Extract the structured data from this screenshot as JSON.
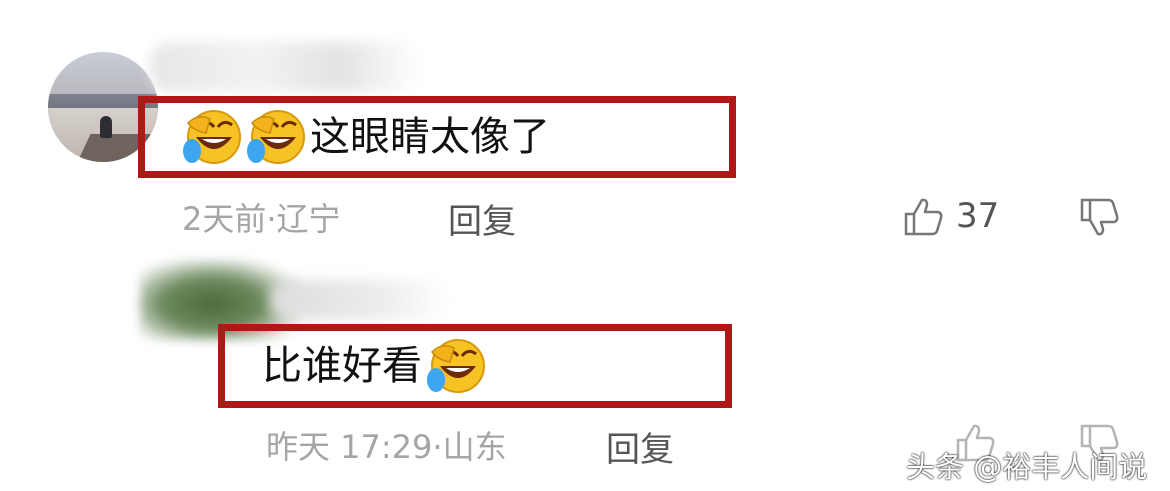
{
  "comment1": {
    "text": "这眼睛太像了",
    "emojis": [
      "laughing-crying-emoji",
      "laughing-crying-emoji"
    ],
    "time": "2天前",
    "separator": "·",
    "location": "辽宁",
    "reply_label": "回复",
    "like_count": "37"
  },
  "comment2": {
    "text": "比谁好看",
    "emojis": [
      "laughing-crying-emoji"
    ],
    "time": "昨天 17:29",
    "separator": "·",
    "location": "山东",
    "reply_label": "回复"
  },
  "watermark": "头条 @裕丰人间说",
  "colors": {
    "highlight_border": "#b01818",
    "meta_text": "#a5a5a5",
    "reply_text": "#555555",
    "emoji_face": "#f7c324"
  }
}
